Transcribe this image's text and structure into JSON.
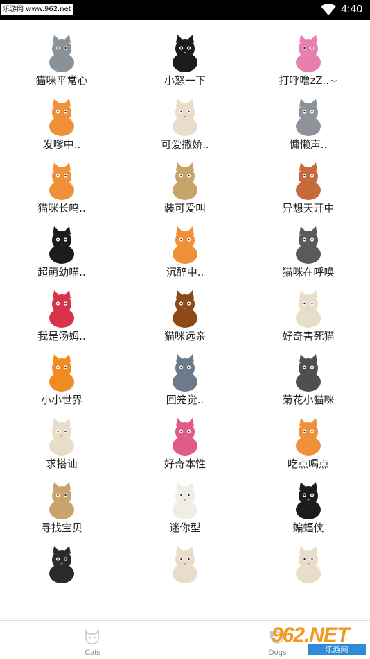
{
  "status_bar": {
    "watermark": "乐游网 www.962.net",
    "time": "4:40"
  },
  "stickers": [
    {
      "label": "猫咪平常心",
      "icon": "gray-cat-sitting-icon",
      "color": "#8a9199"
    },
    {
      "label": "小怒一下",
      "icon": "black-cat-angry-icon",
      "color": "#1c1c1c"
    },
    {
      "label": "打呼噜zZ..~",
      "icon": "pink-cat-sleeping-icon",
      "color": "#e77fb0"
    },
    {
      "label": "发嗲中..",
      "icon": "orange-cat-thinking-icon",
      "color": "#f0913a"
    },
    {
      "label": "可爱撒娇..",
      "icon": "beige-cat-icon",
      "color": "#e7ddc9"
    },
    {
      "label": "慵懒声..",
      "icon": "gray-cat-lazy-icon",
      "color": "#8d9399"
    },
    {
      "label": "猫咪长鸣..",
      "icon": "orange-cat-in-ball-icon",
      "color": "#f0913a"
    },
    {
      "label": "装可爱叫",
      "icon": "cat-in-box-icon",
      "color": "#c9a46a"
    },
    {
      "label": "异想天开中",
      "icon": "cat-with-octopus-icon",
      "color": "#c56a3a"
    },
    {
      "label": "超萌幼喵..",
      "icon": "black-cat-in-litter-box-icon",
      "color": "#1c1c1c"
    },
    {
      "label": "沉醉中..",
      "icon": "orange-cat-stretching-icon",
      "color": "#f0913a"
    },
    {
      "label": "猫咪在呼唤",
      "icon": "gray-cat-dancing-icon",
      "color": "#5a5a5a"
    },
    {
      "label": "我是汤姆..",
      "icon": "cat-in-basket-icon",
      "color": "#d9334a"
    },
    {
      "label": "猫咪远亲",
      "icon": "lion-icon",
      "color": "#8b4a16"
    },
    {
      "label": "好奇害死猫",
      "icon": "cat-in-toilet-icon",
      "color": "#e7ddc9"
    },
    {
      "label": "小小世界",
      "icon": "cat-on-pumpkin-icon",
      "color": "#f08a23"
    },
    {
      "label": "回笼觉..",
      "icon": "cat-sleeping-laptop-icon",
      "color": "#6c7a8c"
    },
    {
      "label": "菊花小猫咪",
      "icon": "gray-cat-behind-icon",
      "color": "#4f4f4f"
    },
    {
      "label": "求搭讪",
      "icon": "cat-with-flower-icon",
      "color": "#e7ddc9"
    },
    {
      "label": "好奇本性",
      "icon": "cat-gift-box-icon",
      "color": "#e05a8a"
    },
    {
      "label": "吃点喝点",
      "icon": "orange-cat-eating-icon",
      "color": "#f0913a"
    },
    {
      "label": "寻找宝贝",
      "icon": "cat-doghouse-icon",
      "color": "#c9a46a"
    },
    {
      "label": "迷你型",
      "icon": "ghost-cat-icon",
      "color": "#f0ede4"
    },
    {
      "label": "蝙蝠侠",
      "icon": "bat-cat-icon",
      "color": "#1c1c1c"
    },
    {
      "label": "",
      "icon": "cat-in-toilet-bowl-icon",
      "color": "#2b2b2b"
    },
    {
      "label": "",
      "icon": "mummy-cat-icon",
      "color": "#e7ddc9"
    },
    {
      "label": "",
      "icon": "angel-cat-icon",
      "color": "#e7ddc9"
    }
  ],
  "bottom_nav": {
    "tabs": [
      {
        "label": "Cats",
        "icon": "cat-tab-icon"
      },
      {
        "label": "Dogs",
        "icon": "dog-tab-icon"
      }
    ],
    "watermark_big": "962.NET",
    "watermark_small": "乐游网"
  }
}
